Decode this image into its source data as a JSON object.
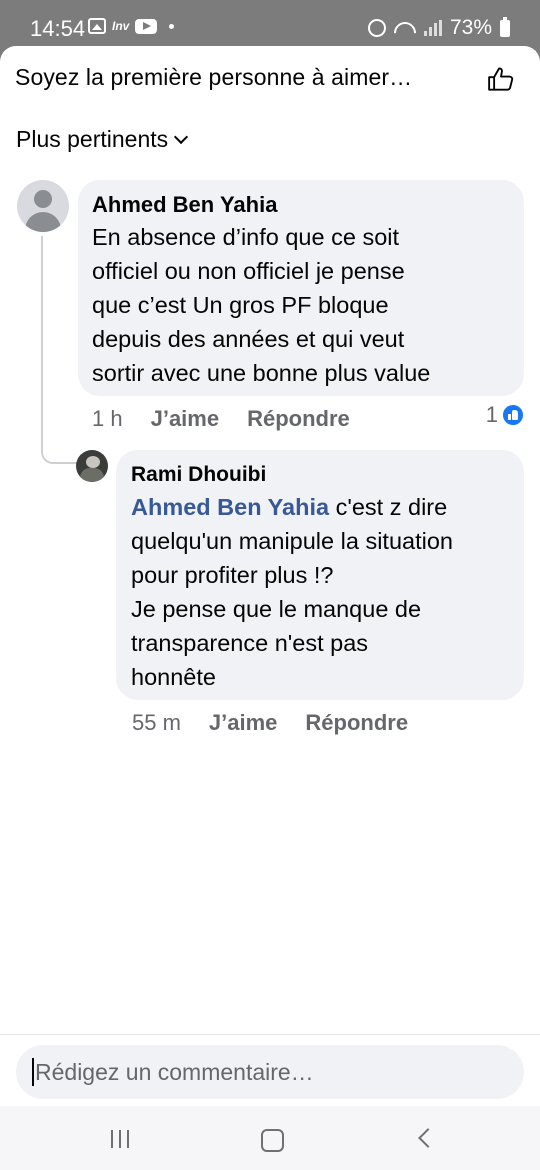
{
  "status_bar": {
    "time": "14:54",
    "inv_label": "Inv",
    "battery": "73%",
    "icons": [
      "gallery-icon",
      "youtube-icon",
      "alarm-icon",
      "wifi-icon",
      "signal-icon",
      "battery-icon"
    ]
  },
  "header": {
    "title": "Soyez la première personne à aimer…",
    "like_icon": "thumbs-up-outline-icon"
  },
  "sort": {
    "label": "Plus pertinents"
  },
  "comments": [
    {
      "author": "Ahmed Ben Yahia",
      "text_lines": [
        "En absence d’info que ce soit",
        "officiel ou non officiel je pense",
        "que c’est Un gros PF bloque",
        "depuis des années et qui veut",
        "sortir avec une bonne plus value"
      ],
      "time": "1 h",
      "like_label": "J’aime",
      "reply_label": "Répondre",
      "reaction_count": "1",
      "reaction_icon": "like-reaction-icon",
      "reaction_color": "#1877f2"
    },
    {
      "author": "Rami Dhouibi",
      "mention": "Ahmed Ben Yahia",
      "text_lines": [
        " c'est z dire",
        "quelqu'un manipule la situation",
        "pour profiter plus !?",
        "Je pense que le manque de",
        "transparence n'est pas",
        "honnête"
      ],
      "time": "55 m",
      "like_label": "J’aime",
      "reply_label": "Répondre"
    }
  ],
  "composer": {
    "placeholder": "Rédigez un commentaire…"
  },
  "colors": {
    "mention": "#385898",
    "bubble": "#f0f2f5",
    "secondary_text": "#65676b"
  }
}
